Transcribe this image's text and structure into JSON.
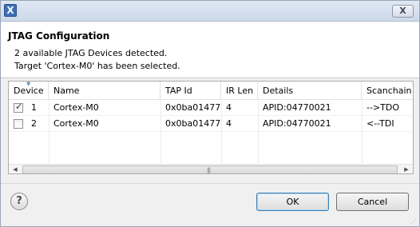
{
  "window": {
    "title_icon": "x-app-icon",
    "close_label": "X"
  },
  "header": {
    "title": "JTAG Configuration",
    "message_line1": "2 available JTAG Devices detected.",
    "message_line2": "Target 'Cortex-M0' has been selected."
  },
  "table": {
    "columns": [
      "Device",
      "Name",
      "TAP Id",
      "IR Len",
      "Details",
      "Scanchain"
    ],
    "rows": [
      {
        "checked": true,
        "num": "1",
        "name": "Cortex-M0",
        "tap_id": "0x0ba01477",
        "ir_len": "4",
        "details": "APID:04770021",
        "scanchain": "-->TDO"
      },
      {
        "checked": false,
        "num": "2",
        "name": "Cortex-M0",
        "tap_id": "0x0ba01477",
        "ir_len": "4",
        "details": "APID:04770021",
        "scanchain": "<--TDI"
      }
    ]
  },
  "scrollbar": {
    "left_arrow": "◀",
    "right_arrow": "▶",
    "grip": "|||"
  },
  "footer": {
    "help_label": "?",
    "ok_label": "OK",
    "cancel_label": "Cancel"
  }
}
